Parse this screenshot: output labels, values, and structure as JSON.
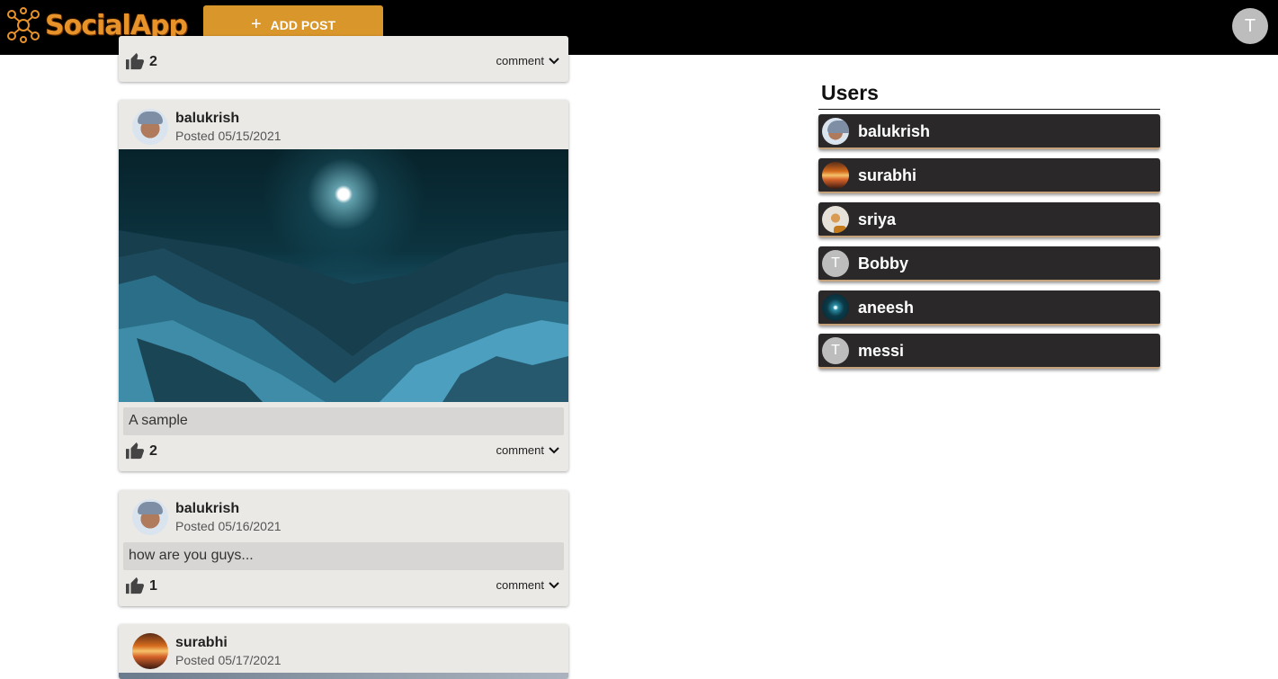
{
  "app": {
    "logo_text": "SocialApp",
    "add_post_label": "ADD POST",
    "current_user_initial": "T",
    "brand_color": "#d9962a"
  },
  "feed": {
    "top_partial": {
      "likes": "2",
      "comment_label": "comment"
    },
    "posts": [
      {
        "author": "balukrish",
        "posted": "Posted 05/15/2021",
        "caption": "A sample",
        "likes": "2",
        "comment_label": "comment",
        "has_image": true
      },
      {
        "author": "balukrish",
        "posted": "Posted 05/16/2021",
        "caption": "how are you guys...",
        "likes": "1",
        "comment_label": "comment",
        "has_image": false
      },
      {
        "author": "surabhi",
        "posted": "Posted 05/17/2021"
      }
    ]
  },
  "users": {
    "title": "Users",
    "items": [
      {
        "name": "balukrish",
        "avatar": "photo"
      },
      {
        "name": "surabhi",
        "avatar": "photo"
      },
      {
        "name": "sriya",
        "avatar": "photo"
      },
      {
        "name": "Bobby",
        "avatar": "letter",
        "initial": "T"
      },
      {
        "name": "aneesh",
        "avatar": "photo"
      },
      {
        "name": "messi",
        "avatar": "letter",
        "initial": "T"
      }
    ]
  }
}
